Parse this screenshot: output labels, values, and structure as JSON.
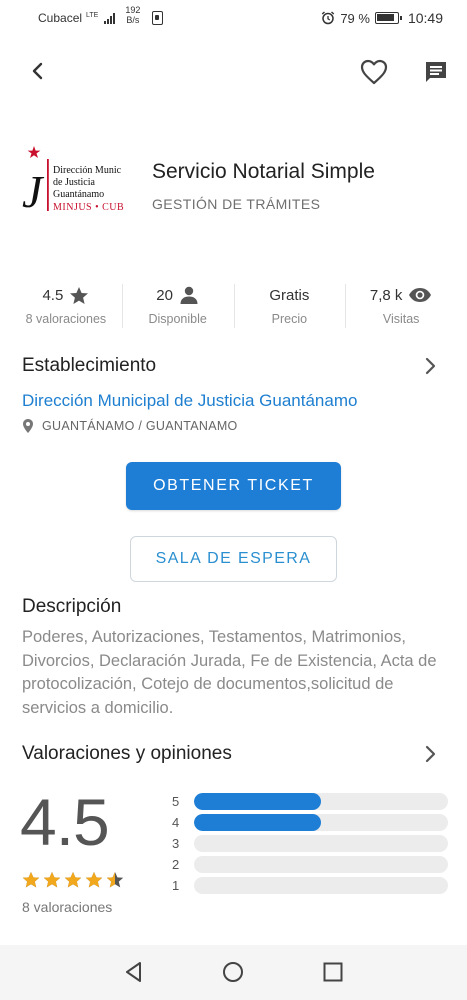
{
  "status_bar": {
    "carrier": "Cubacel",
    "network": "LTE",
    "speed_value": "192",
    "speed_unit": "B/s",
    "battery_percent": "79 %",
    "time": "10:49"
  },
  "header": {
    "title": "Servicio Notarial Simple",
    "subtitle": "GESTIÓN DE TRÁMITES",
    "logo": {
      "line1": "Dirección Munic",
      "line2": "de Justicia",
      "line3": "Guantánamo",
      "line4": "MINJUS • CUB",
      "monogram": "MJ"
    }
  },
  "stats": [
    {
      "value": "4.5",
      "label": "8 valoraciones",
      "icon": "star-icon"
    },
    {
      "value": "20",
      "label": "Disponible",
      "icon": "person-icon"
    },
    {
      "value": "Gratis",
      "label": "Precio",
      "icon": ""
    },
    {
      "value": "7,8 k",
      "label": "Visitas",
      "icon": "eye-icon"
    }
  ],
  "establishment": {
    "section_title": "Establecimiento",
    "name": "Dirección Municipal de Justicia Guantánamo",
    "location": "GUANTÁNAMO / GUANTANAMO"
  },
  "actions": {
    "primary": "OBTENER TICKET",
    "secondary": "SALA DE ESPERA"
  },
  "description": {
    "title": "Descripción",
    "text": "Poderes, Autorizaciones, Testamentos, Matrimonios, Divorcios, Declaración Jurada, Fe de Existencia, Acta de protocolización, Cotejo de documentos,solicitud de servicios a domicilio."
  },
  "ratings": {
    "title": "Valoraciones y opiniones",
    "average": "4.5",
    "stars": 4.5,
    "count_label": "8 valoraciones",
    "distribution": [
      {
        "label": "5",
        "fraction": 0.5
      },
      {
        "label": "4",
        "fraction": 0.5
      },
      {
        "label": "3",
        "fraction": 0
      },
      {
        "label": "2",
        "fraction": 0
      },
      {
        "label": "1",
        "fraction": 0
      }
    ]
  },
  "colors": {
    "accent": "#1e7ed6",
    "link": "#1e7fd0",
    "star": "#f2a81d",
    "logo_red": "#c8102e"
  }
}
